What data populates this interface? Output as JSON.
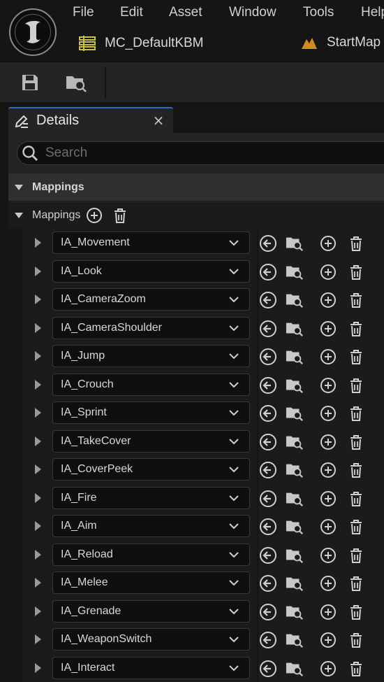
{
  "menu": [
    "File",
    "Edit",
    "Asset",
    "Window",
    "Tools",
    "Help"
  ],
  "asset_tabs": [
    {
      "label": "MC_DefaultKBM",
      "icon": "input-mapping-context-icon",
      "color": "#c8c24a"
    },
    {
      "label": "StartMap",
      "icon": "level-map-icon",
      "color": "#d08a1e"
    }
  ],
  "toolbar": {
    "save_icon": "save-icon",
    "browse_icon": "browse-to-asset-icon"
  },
  "panel": {
    "tab_label": "Details",
    "close_glyph": "×"
  },
  "search": {
    "placeholder": "Search"
  },
  "section": {
    "title": "Mappings"
  },
  "mappings_header": {
    "label": "Mappings"
  },
  "mappings": [
    "IA_Movement",
    "IA_Look",
    "IA_CameraZoom",
    "IA_CameraShoulder",
    "IA_Jump",
    "IA_Crouch",
    "IA_Sprint",
    "IA_TakeCover",
    "IA_CoverPeek",
    "IA_Fire",
    "IA_Aim",
    "IA_Reload",
    "IA_Melee",
    "IA_Grenade",
    "IA_WeaponSwitch",
    "IA_Interact"
  ],
  "colors": {
    "accent": "#2a6fc4",
    "panel": "#242424",
    "background": "#151515"
  }
}
